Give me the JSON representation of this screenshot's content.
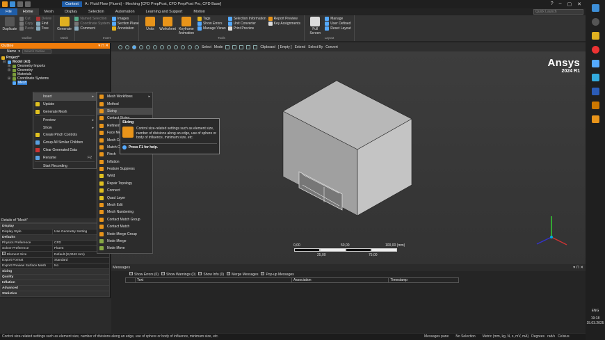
{
  "window": {
    "context_tab": "Context",
    "title": "A : Fluid Flow (Fluent) - Meshing [CFD PrepPost, CFD PrepPost Pro, CFD Base]",
    "controls": [
      "?",
      "–",
      "▢",
      "✕"
    ]
  },
  "tabs": [
    "File",
    "Home",
    "Mesh",
    "Display",
    "Selection",
    "Automation",
    "Learning and Support",
    "Motion"
  ],
  "quick_search_placeholder": "Quick Launch",
  "ribbon": {
    "outline": {
      "items": [
        "Cut",
        "Copy",
        "Paste",
        "Delete",
        "Find",
        "Tree"
      ],
      "big": "Duplicate",
      "label": "Outline"
    },
    "mesh": {
      "big": "Generate",
      "label": "Mesh"
    },
    "insert": {
      "items": [
        "Named Selection",
        "Coordinate System",
        "Comment",
        "Images",
        "Section Plane",
        "Annotation"
      ],
      "label": "Insert"
    },
    "tools": {
      "big": [
        "Units",
        "Worksheet",
        "Keyframe Animation"
      ],
      "items": [
        "Tags",
        "Show Errors",
        "Manage Views",
        "Selection Information",
        "Unit Converter",
        "Print Preview",
        "Report Preview",
        "Key Assignments"
      ],
      "label": "Tools"
    },
    "layout": {
      "big": "Full Screen",
      "items": [
        "Manage",
        "User Defined",
        "Reset Layout"
      ],
      "label": "Layout"
    }
  },
  "outline": {
    "title": "Outline",
    "name_label": "Name",
    "search_placeholder": "Search Outline",
    "tree": [
      "Project*",
      "Model (A3)",
      "Geometry Imports",
      "Geometry",
      "Materials",
      "Coordinate Systems",
      "Mesh"
    ]
  },
  "details": {
    "title": "Details of \"Mesh\"",
    "rows": [
      {
        "k": "Display",
        "v": "",
        "sec": true
      },
      {
        "k": "Display Style",
        "v": "Use Geometry Setting"
      },
      {
        "k": "Defaults",
        "v": "",
        "sec": true
      },
      {
        "k": "Physics Preference",
        "v": "CFD"
      },
      {
        "k": "Solver Preference",
        "v": "Fluent"
      },
      {
        "k": "Element Size",
        "v": "Default (8,0042 mm)"
      },
      {
        "k": "Export Format",
        "v": "Standard"
      },
      {
        "k": "Export Preview Surface Mesh",
        "v": "No"
      },
      {
        "k": "Sizing",
        "v": "",
        "sec": true
      },
      {
        "k": "Quality",
        "v": "",
        "sec": true
      },
      {
        "k": "Inflation",
        "v": "",
        "sec": true
      },
      {
        "k": "Advanced",
        "v": "",
        "sec": true
      },
      {
        "k": "Statistics",
        "v": "",
        "sec": true
      }
    ]
  },
  "view_toolbar": {
    "items": [
      "Select",
      "Mode",
      "Clipboard",
      "[ Empty ]",
      "Extend",
      "Select By",
      "Convert"
    ]
  },
  "brand": {
    "name": "Ansys",
    "version": "2024 R1"
  },
  "scale": {
    "top": [
      "0,00",
      "50,00",
      "100,00 (mm)"
    ],
    "bottom": [
      "25,00",
      "75,00"
    ]
  },
  "context_menu": [
    {
      "label": "Insert",
      "arrow": "▸",
      "hl": true
    },
    {
      "label": "Update"
    },
    {
      "label": "Generate Mesh"
    },
    {
      "label": "Preview",
      "arrow": "▸"
    },
    {
      "label": "Show",
      "arrow": "▸"
    },
    {
      "label": "Create Pinch Controls"
    },
    {
      "label": "Group All Similar Children"
    },
    {
      "label": "Clear Generated Data"
    },
    {
      "label": "Rename",
      "shortcut": "F2"
    },
    {
      "label": "Start Recording"
    }
  ],
  "submenu": [
    {
      "label": "Mesh Workflows",
      "arrow": "▸"
    },
    {
      "label": "Method"
    },
    {
      "label": "Sizing",
      "hl": true
    },
    {
      "label": "Contact Sizing"
    },
    {
      "label": "Refinement"
    },
    {
      "label": "Face Meshing"
    },
    {
      "label": "Mesh Copy"
    },
    {
      "label": "Match Control"
    },
    {
      "label": "Pinch"
    },
    {
      "label": "Inflation"
    },
    {
      "label": "Feature Suppress"
    },
    {
      "label": "Weld"
    },
    {
      "label": "Repair Topology"
    },
    {
      "label": "Connect"
    },
    {
      "label": "Quad Layer"
    },
    {
      "label": "Mesh Edit"
    },
    {
      "label": "Mesh Numbering"
    },
    {
      "label": "Contact Match Group"
    },
    {
      "label": "Contact Match"
    },
    {
      "label": "Node Merge Group"
    },
    {
      "label": "Node Merge"
    },
    {
      "label": "Node Move"
    }
  ],
  "tooltip": {
    "title": "Sizing",
    "body": "Control size-related settings such as element size, number of divisions along an edge, use of sphere or body of influence, minimum size, etc.",
    "help": "Press F1 for help."
  },
  "messages": {
    "title": "Messages",
    "filters": [
      "Show Errors (0)",
      "Show Warnings (0)",
      "Show Info (0)",
      "Merge Messages",
      "Pop-up Messages"
    ],
    "columns": [
      "Text",
      "Association",
      "Timestamp"
    ]
  },
  "status": {
    "left": "Control size-related settings such as element size, number of divisions along an edge, use of sphere or body of influence, minimum size, etc.",
    "right": [
      "Messages pane",
      "No Selection",
      "Metric (mm, kg, N, s, mV, mA)",
      "Degrees",
      "rad/s",
      "Celsius"
    ]
  },
  "clock": {
    "time": "19:18",
    "date": "15.03.2025",
    "lang": "ENG"
  }
}
